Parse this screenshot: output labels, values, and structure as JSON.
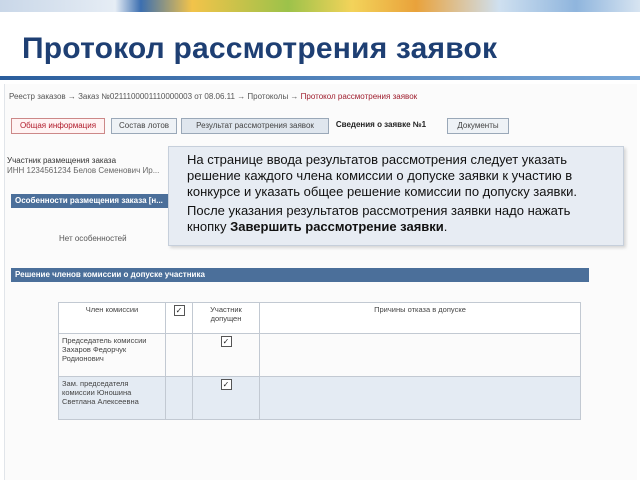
{
  "slide": {
    "title": "Протокол рассмотрения заявок"
  },
  "breadcrumbs": {
    "path": "Реестр заказов → Заказ №0211100001110000003 от 08.06.11 → Протоколы →",
    "current": "Протокол рассмотрения заявок"
  },
  "tabs": [
    {
      "label": "Общая информация"
    },
    {
      "label": "Состав лотов"
    },
    {
      "label": "Результат рассмотрения заявок"
    },
    {
      "label": "Сведения о заявке №1"
    },
    {
      "label": "Документы"
    }
  ],
  "participant": {
    "heading": "Участник размещения заказа",
    "details": "ИНН 1234561234 Белов Семенович Ир..."
  },
  "features_bar": "Особенности размещения заказа [н...",
  "no_features": "Нет особенностей",
  "decision_bar": "Решение членов комиссии о допуске участника",
  "tooltip": {
    "p1": "На странице ввода результатов рассмотрения следует указать решение каждого члена комиссии о допуске заявки к участию в конкурсе и указать общее решение комиссии по допуску заявки.",
    "p2_prefix": "После указания результатов рассмотрения заявки надо нажать кнопку ",
    "p2_bold": "Завершить рассмотрение заявки",
    "p2_suffix": "."
  },
  "table": {
    "headers": [
      "Член комиссии",
      "✓",
      "Участник допущен",
      "Причины отказа в допуске"
    ],
    "rows": [
      {
        "member": "Председатель комиссии Захаров Федорчук Родионович",
        "admitted": true,
        "reason": ""
      },
      {
        "member": "Зам. председателя комиссии Юношина Светлана Алексеевна",
        "admitted": true,
        "reason": ""
      }
    ]
  }
}
